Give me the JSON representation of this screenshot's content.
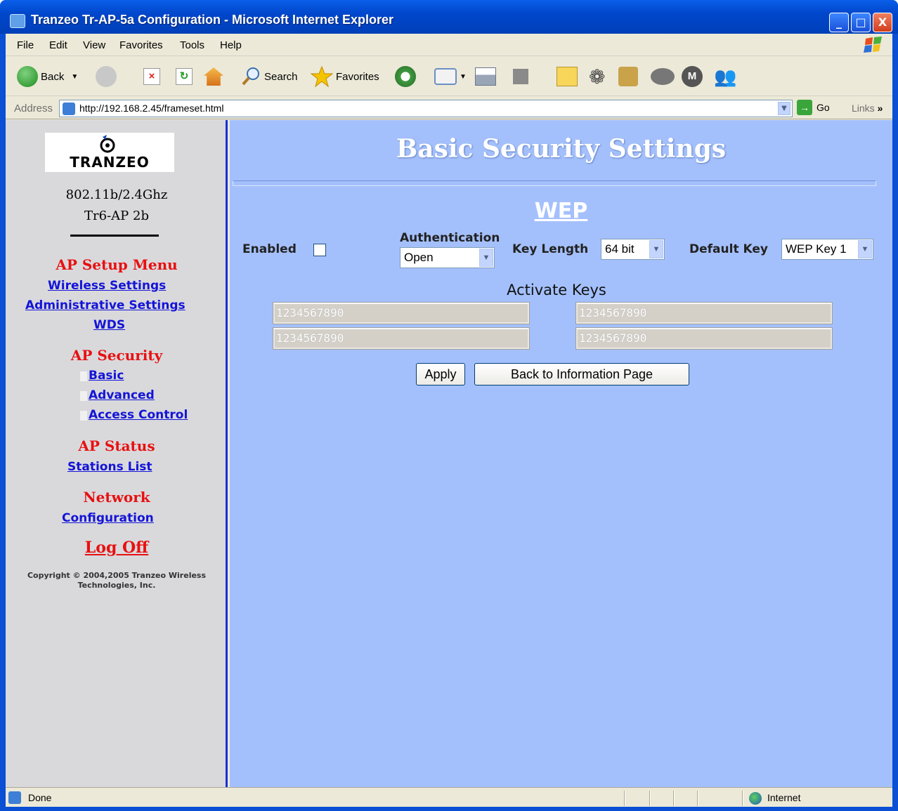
{
  "window": {
    "title": "Tranzeo Tr-AP-5a Configuration - Microsoft Internet Explorer",
    "minimize": "_",
    "maximize": "□",
    "close": "X"
  },
  "menubar": [
    "File",
    "Edit",
    "View",
    "Favorites",
    "Tools",
    "Help"
  ],
  "toolbar": {
    "back": "Back",
    "search": "Search",
    "favorites": "Favorites"
  },
  "address": {
    "label": "Address",
    "url": "http://192.168.2.45/frameset.html",
    "go": "Go",
    "links": "Links",
    "links_chevron": "»"
  },
  "sidebar": {
    "logo_text": "TRANZEO",
    "model_line1": "802.11b/2.4Ghz",
    "model_line2": "Tr6-AP 2b",
    "setup_heading": "AP Setup Menu",
    "setup_links": [
      "Wireless Settings",
      "Administrative Settings",
      "WDS"
    ],
    "security_heading": "AP Security",
    "security_links": [
      "Basic",
      "Advanced",
      "Access Control"
    ],
    "status_heading": "AP Status",
    "status_links": [
      "Stations List"
    ],
    "network_heading": "Network",
    "network_links": [
      "Configuration"
    ],
    "logoff": "Log Off",
    "copyright_line1": "Copyright © 2004,2005 Tranzeo Wireless",
    "copyright_line2": "Technologies, Inc."
  },
  "main": {
    "title": "Basic Security Settings",
    "section": "WEP",
    "enabled_label": "Enabled",
    "enabled_checked": false,
    "authentication_label": "Authentication",
    "authentication_value": "Open",
    "key_length_label": "Key Length",
    "key_length_value": "64 bit",
    "default_key_label": "Default Key",
    "default_key_value": "WEP Key 1",
    "activate_keys_label": "Activate Keys",
    "keys": [
      "1234567890",
      "1234567890",
      "1234567890",
      "1234567890"
    ],
    "apply": "Apply",
    "back_to_info": "Back to Information Page"
  },
  "statusbar": {
    "status": "Done",
    "zone": "Internet"
  },
  "colors": {
    "main_bg": "#a4c0fc",
    "sidebar_bg": "#d9d9dc",
    "heading_red": "#e81010",
    "link_blue": "#1414d8"
  }
}
